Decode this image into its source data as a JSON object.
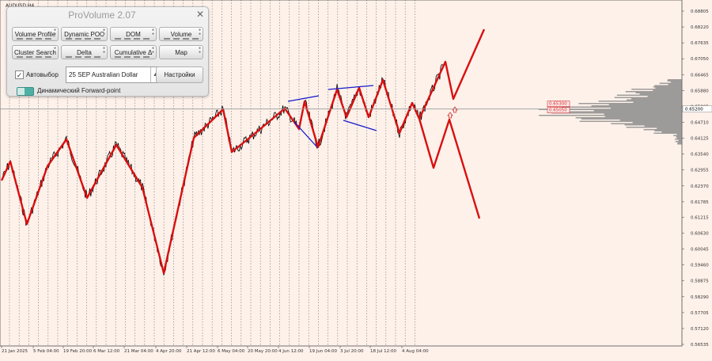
{
  "symbol_label": "AUDUSD,H4",
  "panel": {
    "title": "ProVolume 2.07",
    "close_glyph": "✕",
    "buttons": [
      {
        "label": "Volume Profile",
        "active": true
      },
      {
        "label": "Dynamic POC",
        "active": false
      },
      {
        "label": "DOM",
        "active": false
      },
      {
        "label": "Volume",
        "active": false
      },
      {
        "label": "Cluster Search",
        "active": false
      },
      {
        "label": "Delta",
        "active": false
      },
      {
        "label": "Cumulative Δ",
        "active": false
      },
      {
        "label": "Map",
        "active": false
      }
    ],
    "auto_select": {
      "checked": true,
      "label": "Автовыбор"
    },
    "instrument_select": {
      "value": "25 SEP Australian Dollar"
    },
    "settings_button": "Настройки",
    "forward_point": {
      "label": "Динамический Forward-point"
    }
  },
  "price_axis": {
    "ticks": [
      "0.68805",
      "0.68220",
      "0.67635",
      "0.67050",
      "0.66465",
      "0.65880",
      "0.65295",
      "0.64710",
      "0.64125",
      "0.63540",
      "0.62955",
      "0.62370",
      "0.61785",
      "0.61215",
      "0.60630",
      "0.60045",
      "0.59460",
      "0.58875",
      "0.58290",
      "0.57705",
      "0.57120",
      "0.56535"
    ],
    "current_price": "0.65200",
    "range": [
      0.56535,
      0.68805
    ]
  },
  "time_axis": {
    "ticks": [
      "21 Jan 2025",
      "5 Feb 04:00",
      "19 Feb 20:00",
      "6 Mar 12:00",
      "21 Mar 04:00",
      "4 Apr 20:00",
      "21 Apr 12:00",
      "6 May 04:00",
      "20 May 20:00",
      "4 Jun 12:00",
      "19 Jun 04:00",
      "3 Jul 20:00",
      "18 Jul 12:00",
      "4 Aug 04:00"
    ]
  },
  "price_labels": [
    {
      "text": "0.65300",
      "color": "#d12a2a"
    },
    {
      "text": "0.65050",
      "color": "#d12a2a"
    }
  ],
  "colors": {
    "background": "#fdf1ea",
    "price_line": "#000000",
    "wave_line": "#d90f0f",
    "trend_line": "#1a1acc",
    "volume_profile": "#8c8c8c",
    "session_separator": "#777777",
    "accent": "#4eb0a5"
  },
  "icons": [
    "close-icon",
    "checkbox-icon",
    "dropdown-arrow-icon",
    "toggle-icon",
    "arrow-up-icon",
    "arrow-down-icon"
  ]
}
